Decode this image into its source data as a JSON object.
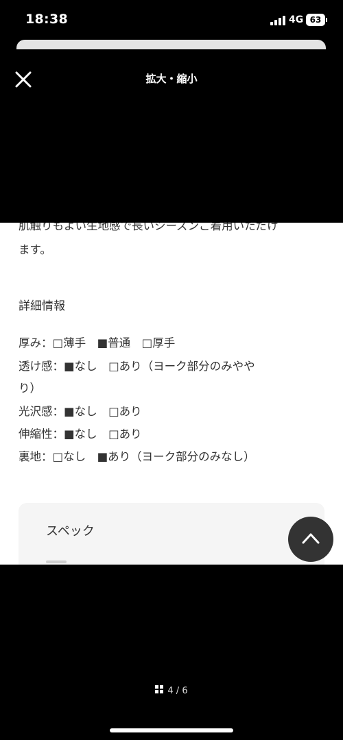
{
  "status_bar": {
    "time": "18:38",
    "network": "4G",
    "battery": "63"
  },
  "viewer": {
    "title": "拡大・縮小",
    "close_icon": "close-icon"
  },
  "content": {
    "cut_off_line": "肌触りもよい生地感で長いシーズンご着用いただけ",
    "line_cont": "ます。",
    "section_title": "詳細情報",
    "details": [
      "厚み：□薄手　■普通　□厚手",
      "透け感：■なし　□あり（ヨーク部分のみやや",
      "り）",
      "光沢感：■なし　□あり",
      "伸縮性：■なし　□あり",
      "裏地：□なし　■あり（ヨーク部分のみなし）"
    ],
    "spec_title": "スペック"
  },
  "scroll_top": {
    "icon": "chevron-up-icon"
  },
  "pager": {
    "text": "4 / 6",
    "icon": "grid-icon"
  }
}
